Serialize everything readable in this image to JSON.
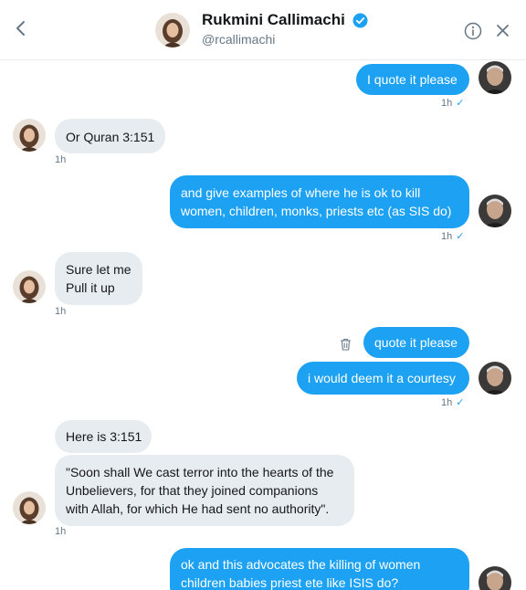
{
  "header": {
    "name": "Rukmini Callimachi",
    "handle": "@rcallimachi"
  },
  "colors": {
    "accent": "#1da1f2",
    "incoming_bubble": "#e6ecf0",
    "secondary_text": "#657786"
  },
  "icons": [
    "chevron-left-icon",
    "verified-badge-icon",
    "info-icon",
    "close-icon",
    "trash-icon",
    "sent-check-icon"
  ],
  "messages": [
    {
      "from": "me",
      "text": "I quote it please",
      "time": "1h",
      "check": "✓"
    },
    {
      "from": "them",
      "text": "Or Quran 3:151",
      "time": "1h"
    },
    {
      "from": "me",
      "text": "and give examples of where he is ok to kill women, children, monks, priests etc (as SIS do)",
      "time": "1h",
      "check": "✓"
    },
    {
      "from": "them",
      "text": "Sure let me Pull it up",
      "time": "1h"
    },
    {
      "from": "me",
      "text": "quote it please"
    },
    {
      "from": "me",
      "text": "i would deem it a courtesy",
      "time": "1h",
      "check": "✓"
    },
    {
      "from": "them",
      "text": "Here is 3:151"
    },
    {
      "from": "them",
      "text": "\"Soon shall We cast terror into the hearts of the Unbelievers, for that they joined companions with Allah, for which He had sent no authority\".",
      "time": "1h"
    },
    {
      "from": "me",
      "text": "ok and this advocates the killing of women children babies priest ete like ISIS do?"
    }
  ]
}
